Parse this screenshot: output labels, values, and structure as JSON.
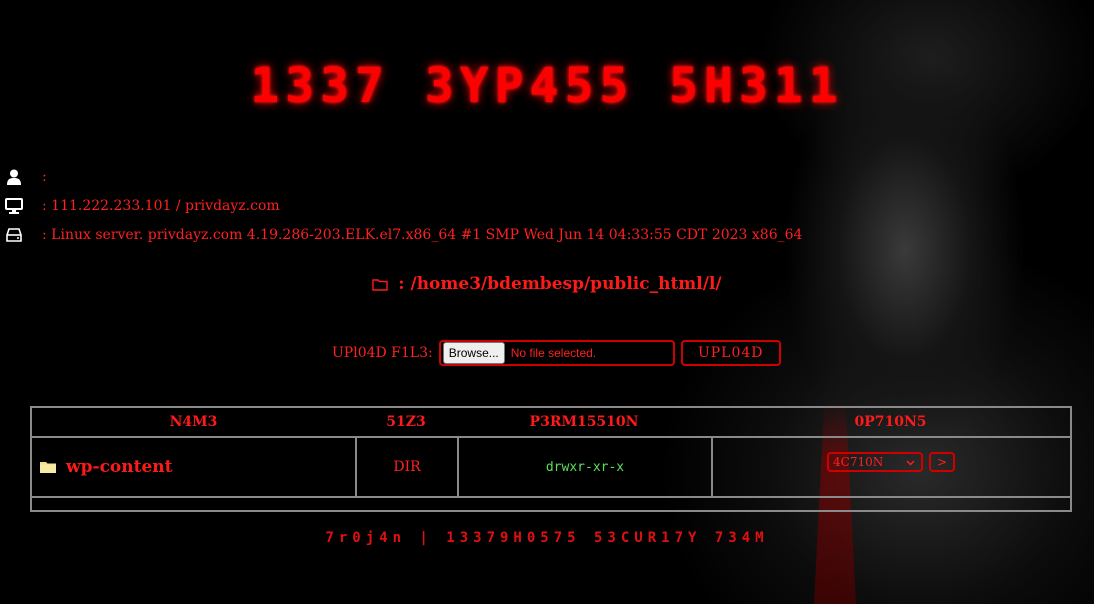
{
  "shell_title": "1337 3YP455 5H311",
  "info": {
    "user_value": ":",
    "server_value": ": 111.222.233.101 / privdayz.com",
    "system_value": ": Linux server. privdayz.com 4.19.286-203.ELK.el7.x86_64 #1 SMP Wed Jun 14 04:33:55 CDT 2023 x86_64"
  },
  "path": {
    "prefix": ":",
    "current": "/home3/bdembesp/public_html/l/"
  },
  "upload": {
    "label": "UPl04D F1L3:",
    "browse_label": "Browse...",
    "no_file_text": "No file selected.",
    "submit_label": "UPL04D"
  },
  "table": {
    "headers": {
      "name": "N4M3",
      "size": "51Z3",
      "permission": "P3RM15510N",
      "options": "0P710N5"
    },
    "rows": [
      {
        "name": "wp-content",
        "size": "DIR",
        "permission": "drwxr-xr-x",
        "action_select": "4C710N",
        "go_label": ">"
      }
    ]
  },
  "footer_text": "7r0j4n | 13379H0575 53CUR17Y 734M",
  "colors": {
    "accent": "#ff1a1a",
    "permission_text": "#5ce05c",
    "border": "#8a8a8a"
  }
}
